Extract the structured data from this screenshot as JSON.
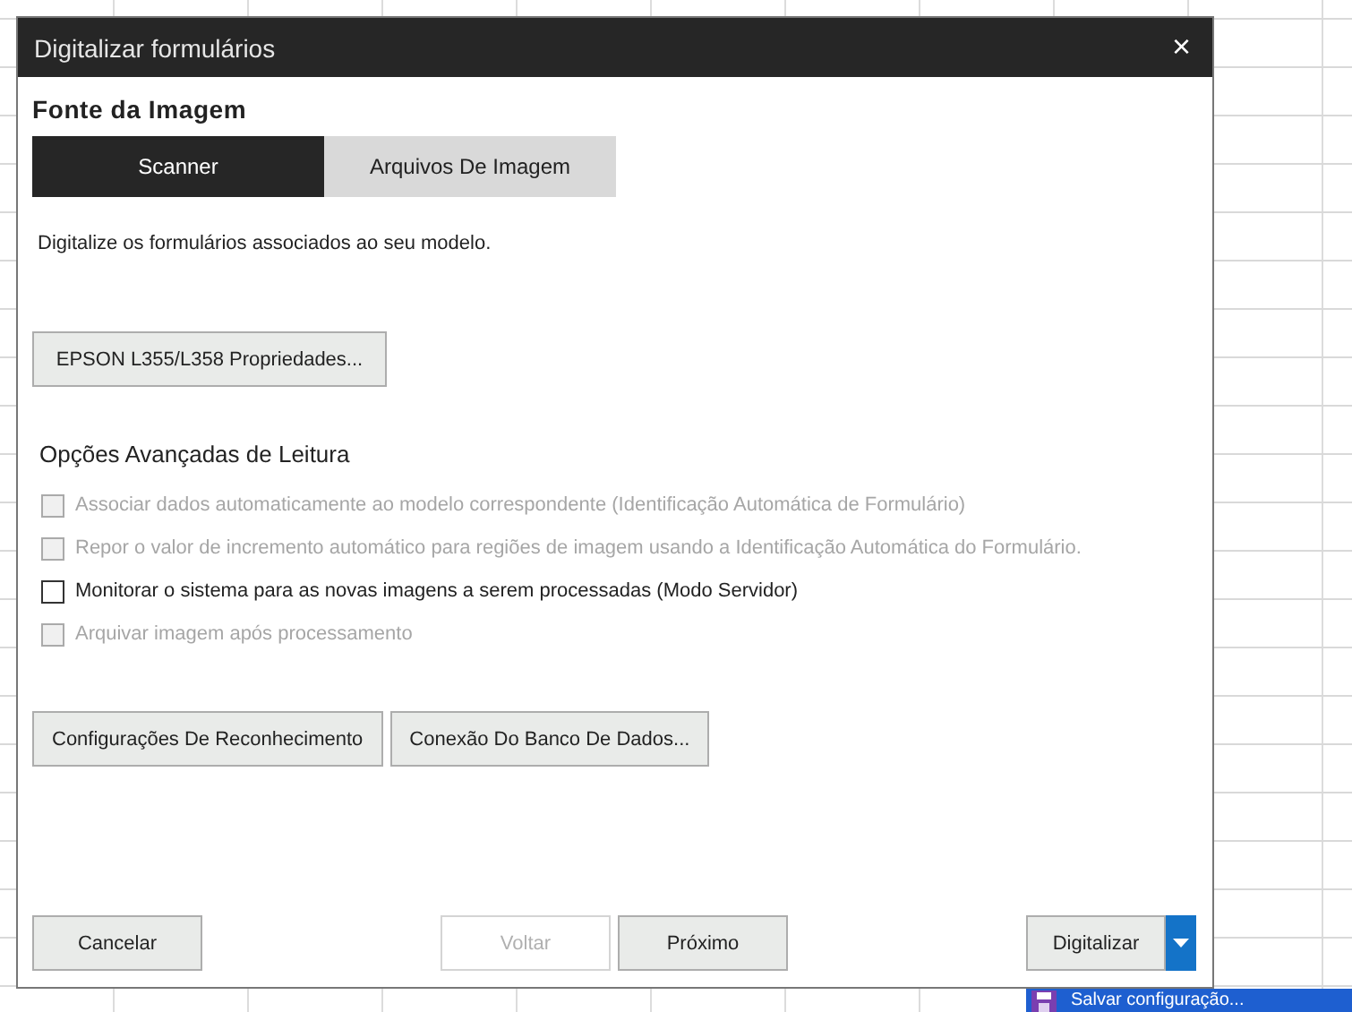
{
  "window": {
    "title": "Digitalizar formulários",
    "close": "×"
  },
  "section_title": "Fonte da Imagem",
  "tabs": [
    {
      "label": "Scanner",
      "selected": true
    },
    {
      "label": "Arquivos De Imagem",
      "selected": false
    }
  ],
  "description": "Digitalize os formulários associados ao seu modelo.",
  "device_button": "EPSON L355/L358 Propriedades...",
  "advanced": {
    "title": "Opções Avançadas de Leitura",
    "options": [
      {
        "label": "Associar dados automaticamente ao modelo correspondente (Identificação Automática de Formulário)",
        "checked": false,
        "disabled": true
      },
      {
        "label": "Repor o valor de incremento automático para regiões de imagem usando a Identificação Automática do Formulário.",
        "checked": false,
        "disabled": true
      },
      {
        "label": "Monitorar o sistema para as novas imagens a serem processadas (Modo Servidor)",
        "checked": false,
        "disabled": false
      },
      {
        "label": "Arquivar imagem após processamento",
        "checked": false,
        "disabled": true
      }
    ]
  },
  "action_buttons": [
    "Configurações De Reconhecimento",
    "Conexão Do Banco De Dados..."
  ],
  "footer": {
    "left": {
      "label": "Cancelar",
      "disabled": false
    },
    "nav": [
      {
        "label": "Voltar",
        "disabled": true
      },
      {
        "label": "Próximo",
        "disabled": false
      }
    ],
    "split_button": {
      "label": "Digitalizar"
    }
  },
  "menu": {
    "items": [
      {
        "label": "Salvar configuração...",
        "selected": true
      }
    ]
  }
}
